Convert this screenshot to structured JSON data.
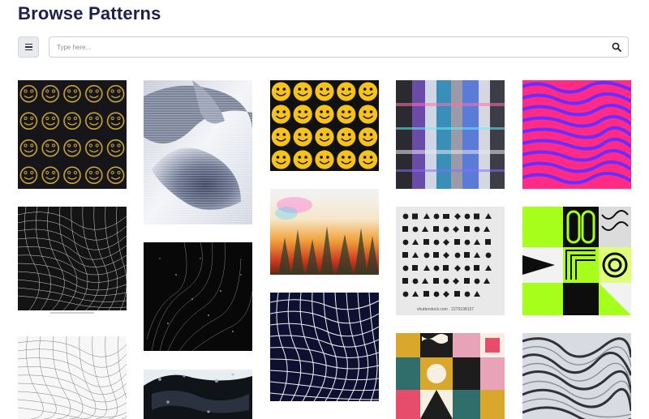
{
  "page": {
    "title": "Browse Patterns"
  },
  "toolbar": {
    "menu_icon": "hamburger-menu-icon",
    "search_placeholder": "Type here...",
    "search_icon": "search-icon"
  },
  "gallery": {
    "watermark": "shutterstock.com · 2279198157",
    "colors": {
      "yellow": "#f7c21b",
      "magenta": "#ff2b86",
      "violet": "#6a2cff",
      "neon_green": "#a6ff1a",
      "navy": "#0d1030"
    }
  }
}
